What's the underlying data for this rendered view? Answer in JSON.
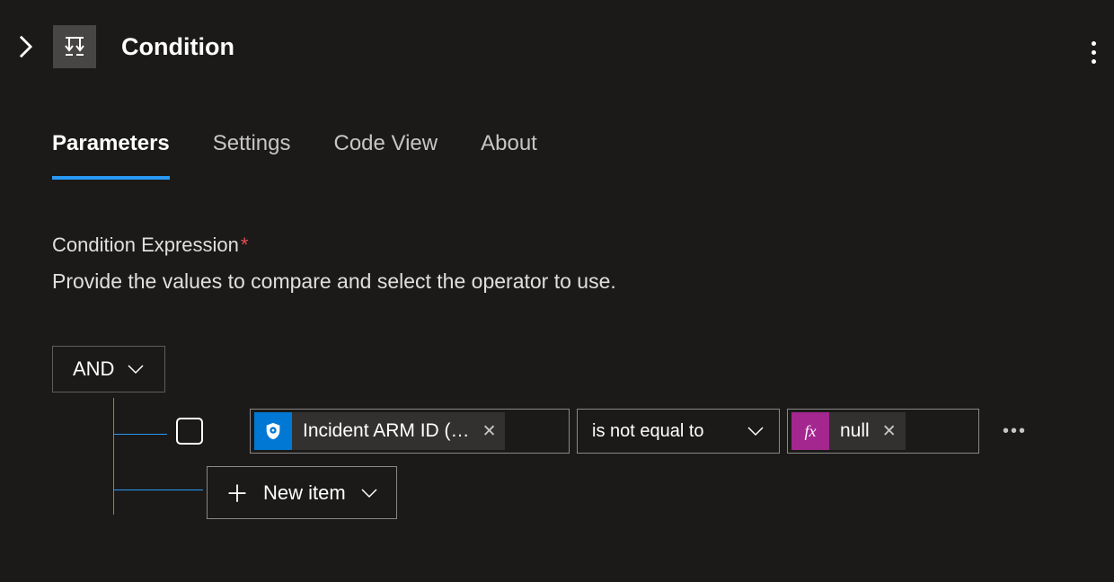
{
  "header": {
    "title": "Condition"
  },
  "tabs": {
    "parameters": "Parameters",
    "settings": "Settings",
    "codeview": "Code View",
    "about": "About"
  },
  "form": {
    "label": "Condition Expression",
    "description": "Provide the values to compare and select the operator to use."
  },
  "expression": {
    "group_operator": "AND",
    "row": {
      "left_token": "Incident ARM ID (…",
      "operator": "is not equal to",
      "right_token": "null",
      "fx_label": "fx"
    },
    "new_item": "New item"
  }
}
